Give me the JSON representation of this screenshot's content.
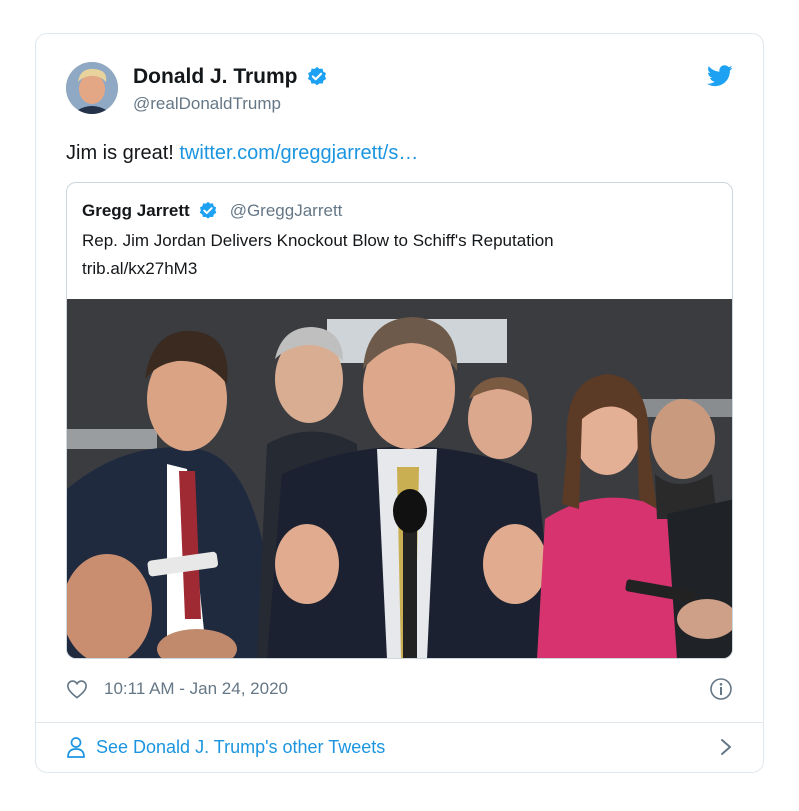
{
  "tweet": {
    "author_name": "Donald J. Trump",
    "author_handle": "@realDonaldTrump",
    "text": "Jim is great!",
    "link_text": "twitter.com/greggjarrett/s…",
    "timestamp": "10:11 AM - Jan 24, 2020"
  },
  "quoted_tweet": {
    "author_name": "Gregg Jarrett",
    "author_handle": "@GreggJarrett",
    "text": "Rep. Jim Jordan Delivers Knockout Blow to Schiff's Reputation",
    "url": "trib.al/kx27hM3"
  },
  "footer": {
    "see_more_label": "See Donald J. Trump's other Tweets"
  },
  "icons": {
    "verified": "verified-badge-icon",
    "twitter": "twitter-bird-icon",
    "like": "heart-icon",
    "info": "info-icon",
    "profile": "person-icon",
    "chevron": "chevron-right-icon"
  },
  "colors": {
    "link": "#1b95e0",
    "verified": "#1da1f2",
    "secondary_text": "#657786",
    "magenta_jacket": "#d6336f"
  }
}
